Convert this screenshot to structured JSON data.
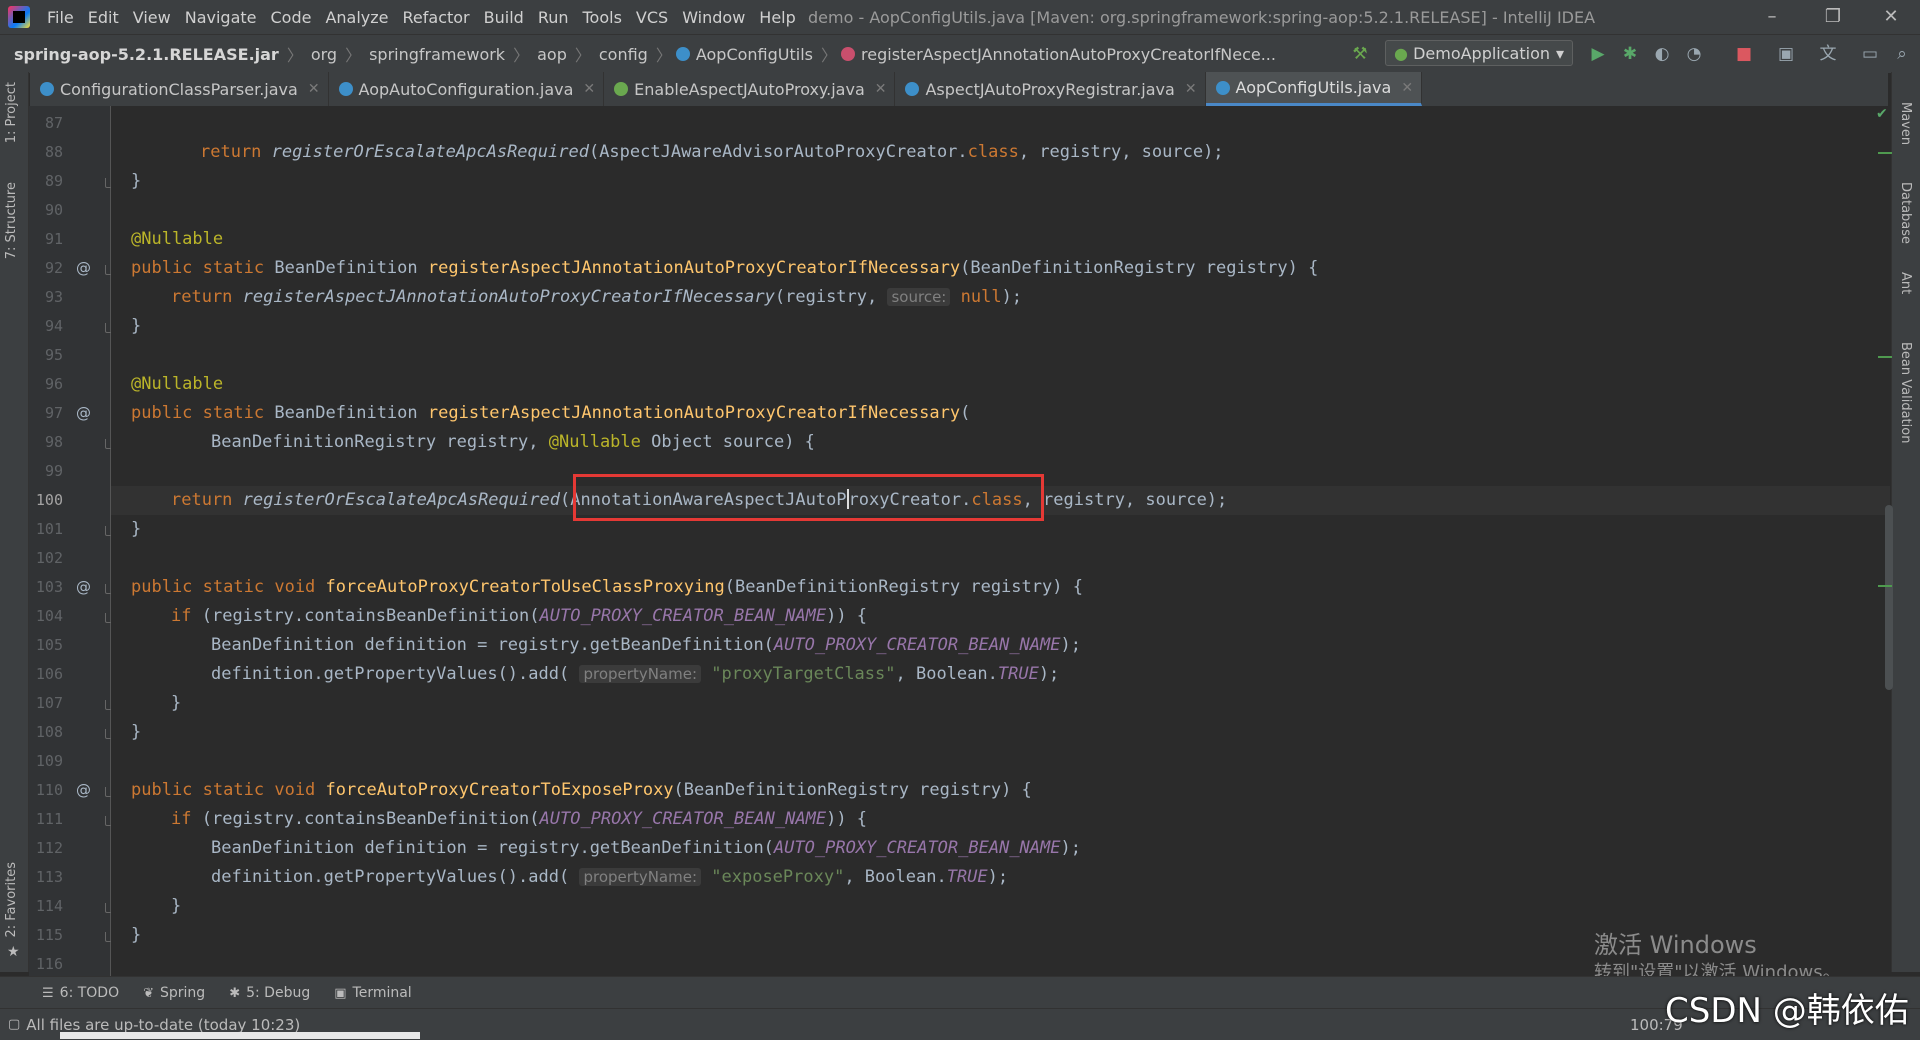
{
  "app": {
    "menu": [
      "File",
      "Edit",
      "View",
      "Navigate",
      "Code",
      "Analyze",
      "Refactor",
      "Build",
      "Run",
      "Tools",
      "VCS",
      "Window",
      "Help"
    ],
    "window_title": "demo - AopConfigUtils.java [Maven: org.springframework:spring-aop:5.2.1.RELEASE] - IntelliJ IDEA"
  },
  "breadcrumbs": {
    "jar": "spring-aop-5.2.1.RELEASE.jar",
    "items": [
      "org",
      "springframework",
      "aop",
      "config",
      "AopConfigUtils",
      "registerAspectJAnnotationAutoProxyCreatorIfNece..."
    ]
  },
  "run_config": "DemoApplication",
  "tabs": [
    "ConfigurationClassParser.java",
    "AopAutoConfiguration.java",
    "EnableAspectJAutoProxy.java",
    "AspectJAutoProxyRegistrar.java",
    "AopConfigUtils.java"
  ],
  "active_tab": "AopConfigUtils.java",
  "left_tools": [
    "1: Project",
    "7: Structure",
    "2: Favorites"
  ],
  "right_tools": [
    "Maven",
    "Database",
    "Ant",
    "Bean Validation"
  ],
  "code": {
    "line_numbers": [
      "87",
      "88",
      "89",
      "90",
      "91",
      "92",
      "93",
      "94",
      "95",
      "96",
      "97",
      "98",
      "99",
      "100",
      "101",
      "102",
      "103",
      "104",
      "105",
      "106",
      "107",
      "108",
      "109",
      "110",
      "111",
      "112",
      "113",
      "114",
      "115",
      "116"
    ],
    "current_line": "100",
    "t_return": "return",
    "t_public": "public",
    "t_static": "static",
    "t_void": "void",
    "t_if": "if",
    "t_null": "null",
    "t_class": "class",
    "t_nullable": "@Nullable",
    "fn_escalate": "registerOrEscalateApcAsRequired",
    "fn_register_decl": "registerAspectJAnnotationAutoProxyCreatorIfNecessary",
    "fn_force_class": "forceAutoProxyCreatorToUseClassProxying",
    "fn_force_expose": "forceAutoProxyCreatorToExposeProxy",
    "const_bean_name": "AUTO_PROXY_CREATOR_BEAN_NAME",
    "const_true": "TRUE",
    "hint_source": "source:",
    "hint_property": "propertyName:",
    "str_target": "\"proxyTargetClass\"",
    "str_expose": "\"exposeProxy\"",
    "l88_a": "(AspectJAwareAdvisorAutoProxyCreator.",
    "l88_b": ", registry, source);",
    "brace_close": "}",
    "brace_close_ind": "}",
    "bean_def": "BeanDefinition",
    "l92_params": "(BeanDefinitionRegistry registry) {",
    "l93_a": "(registry, ",
    "l93_b": ");",
    "open_paren": "(",
    "l98_a": "BeanDefinitionRegistry registry, ",
    "l98_b": "Object source) {",
    "l100_a": "AnnotationAwareAspectJAutoP",
    "l100_b": "roxyCreator.",
    "l100_c": ",",
    "l100_d": " registry, source);",
    "l104_a": "(registry.containsBeanDefinition(",
    "l104_b": ")) {",
    "l105_a": "BeanDefinition definition = registry.getBeanDefinition(",
    "l105_b": ");",
    "l106_a": "definition.getPropertyValues().add(",
    "l106_b": ", Boolean.",
    "l106_c": ");"
  },
  "toolwindows": [
    "6: TODO",
    "Spring",
    "5: Debug",
    "Terminal"
  ],
  "status": {
    "message": "All files are up-to-date (today 10:23)",
    "position": "100:79"
  },
  "watermark": {
    "line1": "激活 Windows",
    "line2": "转到\"设置\"以激活 Windows。",
    "csdn": "CSDN @韩依佑"
  },
  "colors": {
    "keyword": "#cc7832",
    "method": "#ffc66d",
    "annotation": "#bbb529",
    "constant": "#9876aa",
    "string": "#6a8759",
    "highlight_box": "#e53935",
    "tab_underline": "#4a88c7"
  }
}
